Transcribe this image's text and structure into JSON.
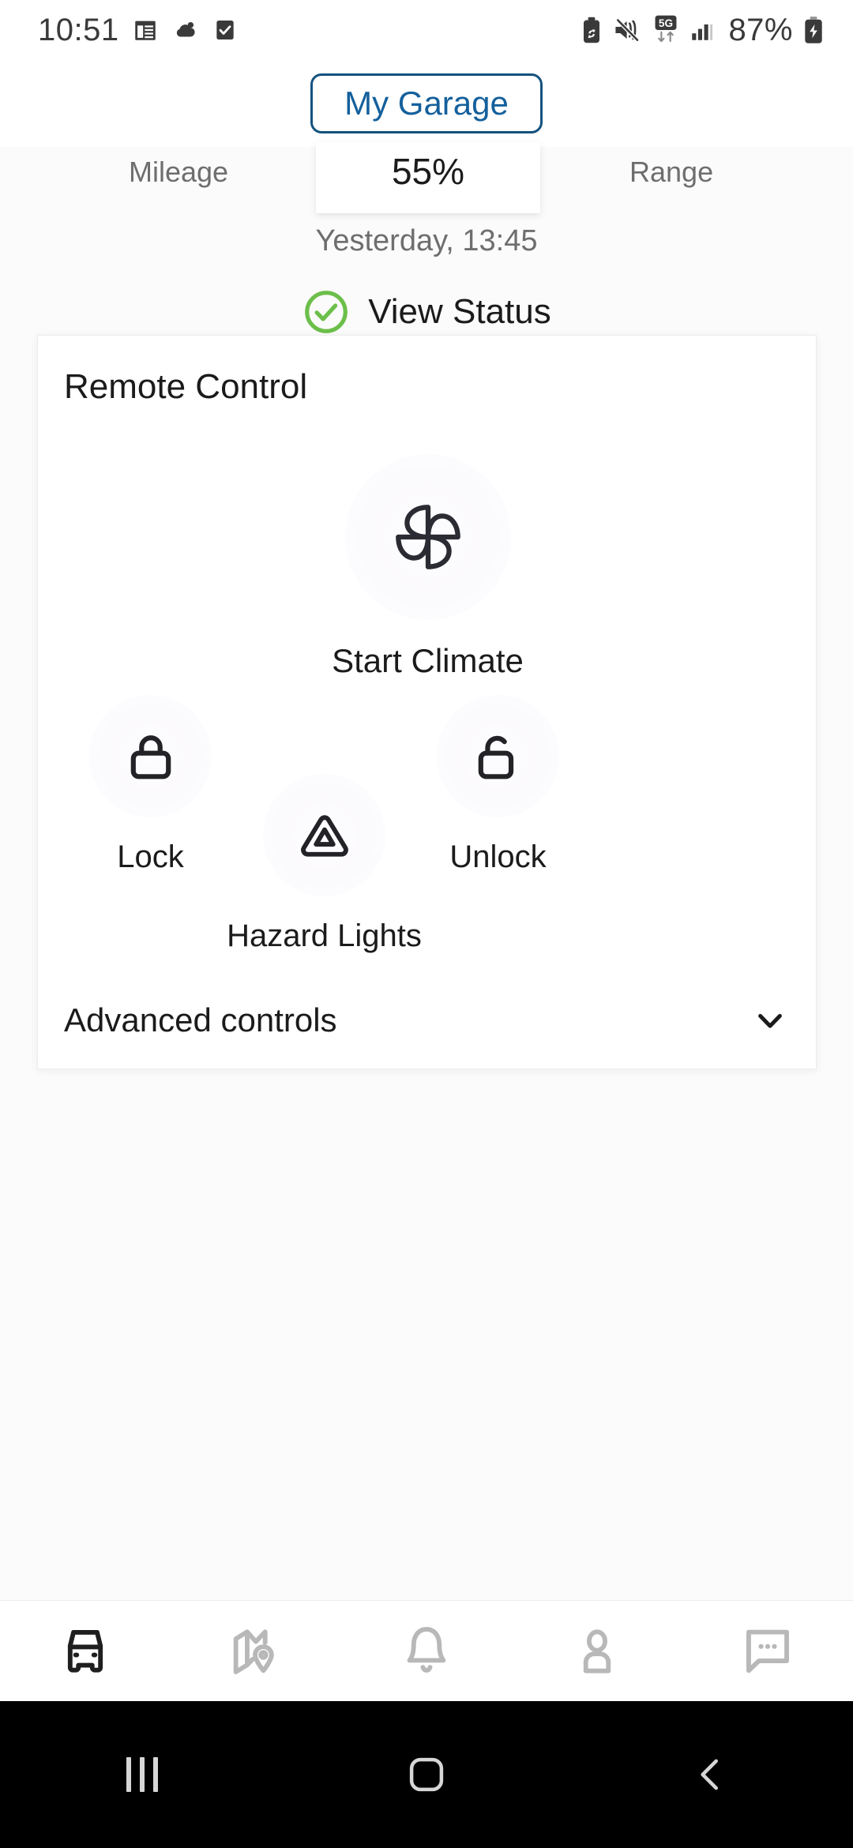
{
  "status_bar": {
    "time": "10:51",
    "battery_percent": "87%",
    "left_icons": [
      "calendar-icon",
      "weather-cloud-icon",
      "checkbox-icon"
    ],
    "right_icons": [
      "battery-saver-icon",
      "mute-vibrate-icon",
      "5g-network-icon",
      "signal-bars-icon",
      "battery-charging-icon"
    ]
  },
  "header": {
    "garage_button": "My Garage",
    "accent_color": "#14609c"
  },
  "vehicle_stats": {
    "mileage_label": "Mileage",
    "range_label": "Range",
    "battery_level": "55%",
    "timestamp": "Yesterday, 13:45",
    "view_status_label": "View Status",
    "status_ok_color": "#6cbf4a"
  },
  "remote_control": {
    "title": "Remote Control",
    "climate": {
      "label": "Start Climate",
      "icon": "fan-icon"
    },
    "lock": {
      "label": "Lock",
      "icon": "lock-closed-icon"
    },
    "unlock": {
      "label": "Unlock",
      "icon": "lock-open-icon"
    },
    "hazard": {
      "label": "Hazard Lights",
      "icon": "hazard-triangle-icon"
    },
    "advanced": {
      "label": "Advanced controls",
      "icon": "chevron-down-icon"
    }
  },
  "tab_bar": {
    "active_color": "#1f1f1f",
    "inactive_color": "#b8b8b8",
    "tabs": [
      {
        "name": "vehicle",
        "icon": "car-icon",
        "active": true
      },
      {
        "name": "map",
        "icon": "map-pin-icon",
        "active": false
      },
      {
        "name": "notifications",
        "icon": "bell-icon",
        "active": false
      },
      {
        "name": "profile",
        "icon": "person-icon",
        "active": false
      },
      {
        "name": "messages",
        "icon": "chat-bubble-icon",
        "active": false
      }
    ]
  },
  "system_nav": {
    "recent_label": "recent-apps",
    "home_label": "home",
    "back_label": "back"
  }
}
